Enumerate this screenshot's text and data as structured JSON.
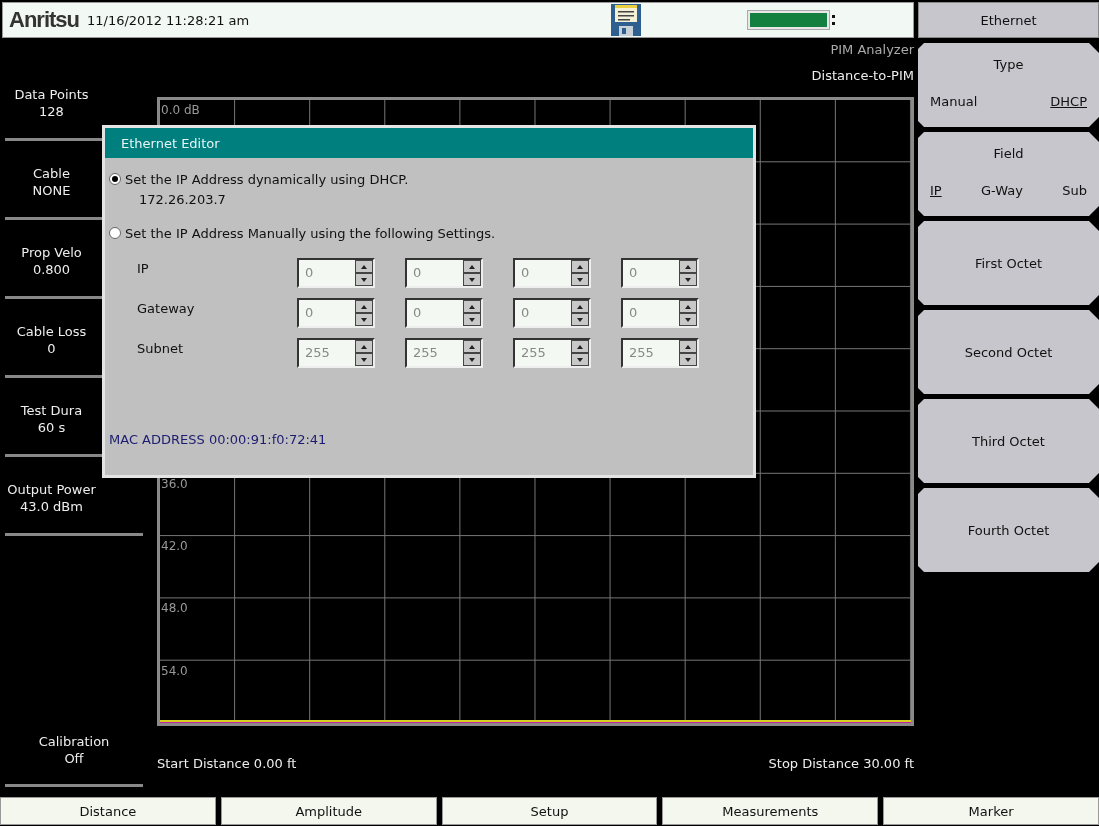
{
  "status_bar": {
    "logo": "Anritsu",
    "datetime": "11/16/2012 11:28:21 am"
  },
  "mode": {
    "instrument": "PIM Analyzer",
    "measurement": "Distance-to-PIM"
  },
  "parameters": [
    {
      "label": "Data Points",
      "value": "128"
    },
    {
      "label": "Cable",
      "value": "NONE"
    },
    {
      "label": "Prop Velo",
      "value": "0.800"
    },
    {
      "label": "Cable Loss",
      "value": "0"
    },
    {
      "label": "Test Dura",
      "value": "60 s"
    },
    {
      "label": "Output Power",
      "value": "43.0 dBm"
    }
  ],
  "calibration": {
    "label": "Calibration",
    "value": "Off"
  },
  "graph": {
    "rows": [
      {
        "label": "0.0 dB"
      },
      {},
      {},
      {},
      {},
      {},
      {
        "label": "36.0"
      },
      {
        "label": "42.0"
      },
      {
        "label": "48.0"
      },
      {
        "label": "54.0"
      }
    ],
    "start_label": "Start Distance 0.00 ft",
    "stop_label": "Stop Distance 30.00 ft"
  },
  "dialog": {
    "title": "Ethernet Editor",
    "options": [
      {
        "label": "Set the IP Address dynamically using DHCP.",
        "detail": "172.26.203.7",
        "selected": true
      },
      {
        "label": "Set the IP Address Manually using the following Settings.",
        "selected": false
      }
    ],
    "fields": [
      {
        "label": "IP",
        "octets": [
          "0",
          "0",
          "0",
          "0"
        ]
      },
      {
        "label": "Gateway",
        "octets": [
          "0",
          "0",
          "0",
          "0"
        ]
      },
      {
        "label": "Subnet",
        "octets": [
          "255",
          "255",
          "255",
          "255"
        ]
      }
    ],
    "mac": "MAC ADDRESS 00:00:91:f0:72:41"
  },
  "menu": {
    "title": "Ethernet",
    "buttons": [
      {
        "kind": "toggle",
        "label": "Type",
        "options": [
          {
            "label": "Manual",
            "selected": false
          },
          {
            "label": "DHCP",
            "selected": true
          }
        ]
      },
      {
        "kind": "toggle",
        "label": "Field",
        "options": [
          {
            "label": "IP",
            "selected": true
          },
          {
            "label": "G-Way",
            "selected": false
          },
          {
            "label": "Sub",
            "selected": false
          }
        ]
      },
      {
        "kind": "action",
        "label": "First Octet"
      },
      {
        "kind": "action",
        "label": "Second Octet"
      },
      {
        "kind": "action",
        "label": "Third Octet"
      },
      {
        "kind": "action",
        "label": "Fourth Octet"
      }
    ]
  },
  "bottom_tabs": [
    {
      "label": "Distance"
    },
    {
      "label": "Amplitude"
    },
    {
      "label": "Setup"
    },
    {
      "label": "Measurements"
    },
    {
      "label": "Marker"
    }
  ]
}
